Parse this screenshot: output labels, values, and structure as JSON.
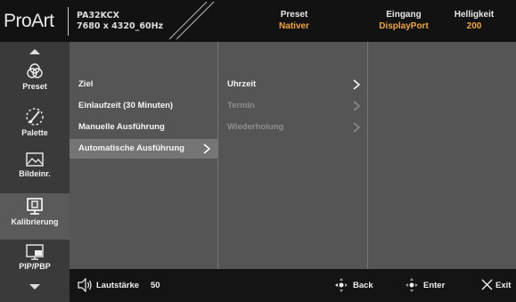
{
  "header": {
    "logo": "ProArt",
    "model": "PA32KCX",
    "resolution": "7680 x 4320_60Hz",
    "preset_label": "Preset",
    "preset_value": "Nativer",
    "input_label": "Eingang",
    "input_value": "DisplayPort",
    "brightness_label": "Helligkeit",
    "brightness_value": "200"
  },
  "sidebar": {
    "items": [
      {
        "label": "Preset",
        "icon": "preset-icon"
      },
      {
        "label": "Palette",
        "icon": "palette-icon"
      },
      {
        "label": "Bildeinr.",
        "icon": "image-icon"
      },
      {
        "label": "Kalibrierung",
        "icon": "calibration-icon",
        "active": true
      },
      {
        "label": "PIP/PBP",
        "icon": "pip-icon"
      }
    ]
  },
  "menu_level1": [
    {
      "label": "Ziel"
    },
    {
      "label": "Einlaufzeit (30 Minuten)"
    },
    {
      "label": "Manuelle Ausführung"
    },
    {
      "label": "Automatische Ausführung",
      "selected": true
    }
  ],
  "menu_level2": [
    {
      "label": "Uhrzeit",
      "enabled": true
    },
    {
      "label": "Termin",
      "enabled": false
    },
    {
      "label": "Wiederholung",
      "enabled": false
    }
  ],
  "footer": {
    "volume_label": "Lautstärke",
    "volume_value": "50",
    "back_label": "Back",
    "enter_label": "Enter",
    "exit_label": "Exit"
  },
  "colors": {
    "accent": "#f0a830",
    "selected_row": "#757575",
    "panel": "#555555",
    "sidebar": "#3a3a3a"
  }
}
